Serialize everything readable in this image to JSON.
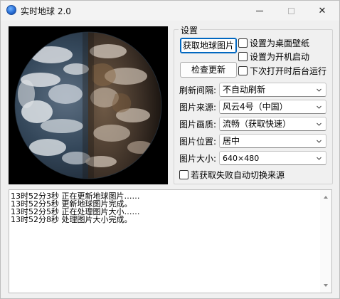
{
  "window": {
    "title": "实时地球 2.0",
    "minimize_label": "",
    "maximize_label": "",
    "close_label": "✕"
  },
  "settings": {
    "group_title": "设置",
    "fetch_button": "获取地球图片",
    "check_update_button": "检查更新",
    "checkboxes": [
      {
        "label": "设置为桌面壁纸",
        "checked": false
      },
      {
        "label": "设置为开机启动",
        "checked": false
      },
      {
        "label": "下次打开时后台运行",
        "checked": false
      }
    ],
    "fields": [
      {
        "label": "刷新间隔:",
        "value": "不自动刷新"
      },
      {
        "label": "图片来源:",
        "value": "风云4号（中国）"
      },
      {
        "label": "图片画质:",
        "value": "流畅（获取快速）"
      },
      {
        "label": "图片位置:",
        "value": "居中"
      },
      {
        "label": "图片大小:",
        "value": "640×480"
      }
    ],
    "fallback_checkbox": {
      "label": "若获取失败自动切换来源",
      "checked": false
    }
  },
  "log": {
    "lines": [
      "13时52分3秒  正在更新地球图片……",
      "13时52分5秒  更新地球图片完成。",
      "13时52分5秒  正在处理图片大小……",
      "13时52分8秒  处理图片大小完成。"
    ]
  },
  "colors": {
    "accent": "#0067c0",
    "window_bg": "#f0f0f0",
    "image_bg": "#000000"
  },
  "icons": {
    "app": "globe-icon",
    "scroll_up": "chevron-up-icon",
    "scroll_down": "chevron-down-icon",
    "combo_arrow": "chevron-down-icon"
  }
}
